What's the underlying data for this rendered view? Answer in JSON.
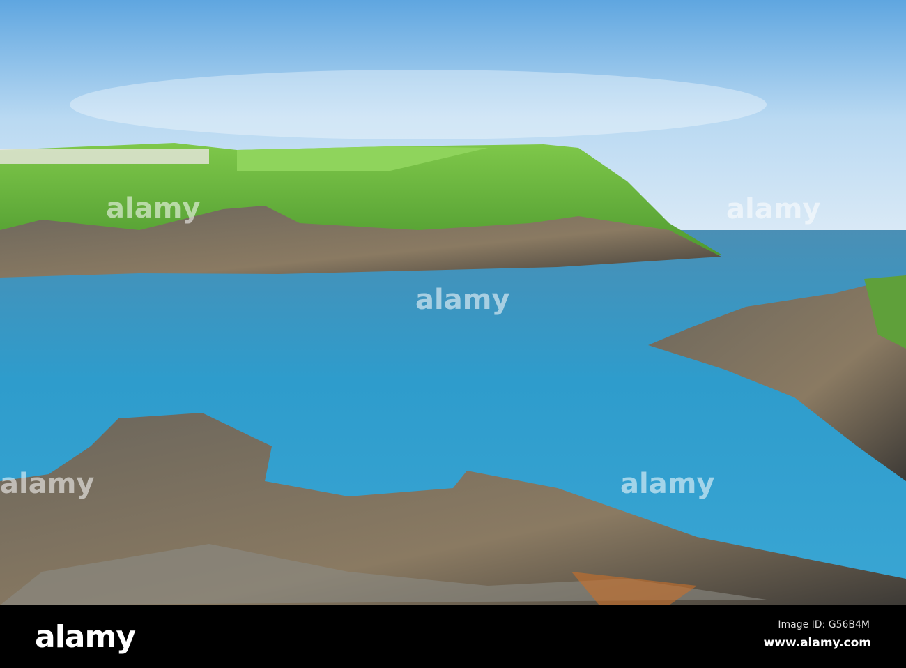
{
  "watermark": {
    "logo_text": "alamy",
    "image_id": "Image ID: G56B4M",
    "url": "www.alamy.com"
  },
  "colors": {
    "sky": "#8fc3ec",
    "sea": "#2f8fc0",
    "grass": "#5fae3a",
    "rock": "#5a554c",
    "bar": "#000000"
  }
}
